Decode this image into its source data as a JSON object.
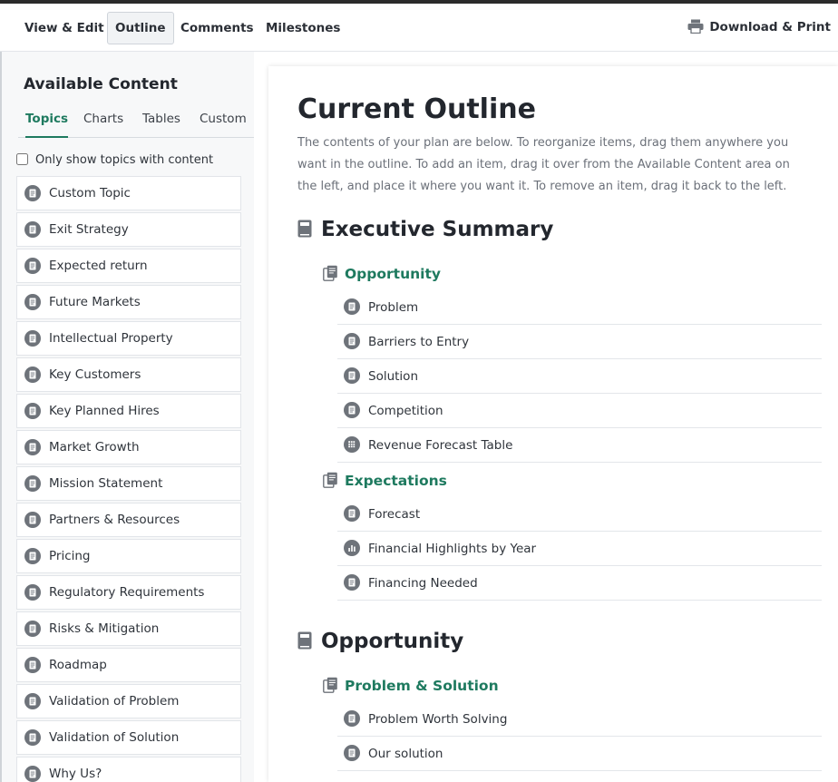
{
  "topbar": {
    "tabs": [
      "View & Edit",
      "Outline",
      "Comments",
      "Milestones"
    ],
    "active_tab": "Outline",
    "download_label": "Download & Print"
  },
  "sidebar": {
    "title": "Available Content",
    "tabs": [
      "Topics",
      "Charts",
      "Tables",
      "Custom"
    ],
    "active_tab": "Topics",
    "filter_label": "Only show topics with content",
    "items": [
      "Custom Topic",
      "Exit Strategy",
      "Expected return",
      "Future Markets",
      "Intellectual Property",
      "Key Customers",
      "Key Planned Hires",
      "Market Growth",
      "Mission Statement",
      "Partners & Resources",
      "Pricing",
      "Regulatory Requirements",
      "Risks & Mitigation",
      "Roadmap",
      "Validation of Problem",
      "Validation of Solution",
      "Why Us?"
    ]
  },
  "main": {
    "title": "Current Outline",
    "description": "The contents of your plan are below. To reorganize items, drag them anywhere you want in the outline. To add an item, drag it over from the Available Content area on the left, and place it where you want it. To remove an item, drag it back to the left.",
    "sections": [
      {
        "title": "Executive Summary",
        "groups": [
          {
            "title": "Opportunity",
            "items": [
              {
                "label": "Problem",
                "icon": "document-icon"
              },
              {
                "label": "Barriers to Entry",
                "icon": "document-icon"
              },
              {
                "label": "Solution",
                "icon": "document-icon"
              },
              {
                "label": "Competition",
                "icon": "document-icon"
              },
              {
                "label": "Revenue Forecast Table",
                "icon": "table-grid-icon"
              }
            ]
          },
          {
            "title": "Expectations",
            "items": [
              {
                "label": "Forecast",
                "icon": "document-icon"
              },
              {
                "label": "Financial Highlights by Year",
                "icon": "bar-chart-icon"
              },
              {
                "label": "Financing Needed",
                "icon": "document-icon"
              }
            ]
          }
        ]
      },
      {
        "title": "Opportunity",
        "groups": [
          {
            "title": "Problem & Solution",
            "items": [
              {
                "label": "Problem Worth Solving",
                "icon": "document-icon"
              },
              {
                "label": "Our solution",
                "icon": "document-icon"
              }
            ]
          }
        ]
      }
    ]
  },
  "colors": {
    "accent": "#1e7a5f",
    "icon_gray": "#6e737a",
    "text_dark": "#23272e",
    "text_muted": "#6b7079"
  }
}
